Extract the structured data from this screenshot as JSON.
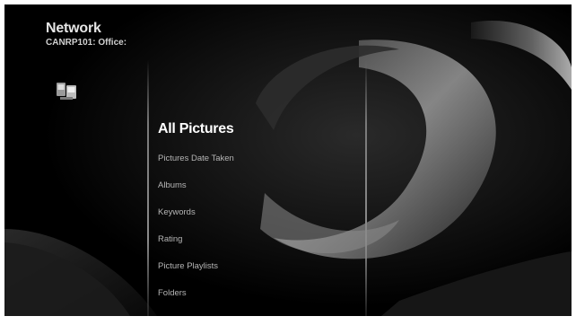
{
  "header": {
    "title": "Network",
    "subtitle": "CANRP101: Office:"
  },
  "icons": {
    "network": "network-computers-icon"
  },
  "menu": {
    "items": [
      {
        "label": "All Pictures",
        "selected": true
      },
      {
        "label": "Pictures Date Taken",
        "selected": false
      },
      {
        "label": "Albums",
        "selected": false
      },
      {
        "label": "Keywords",
        "selected": false
      },
      {
        "label": "Rating",
        "selected": false
      },
      {
        "label": "Picture Playlists",
        "selected": false
      },
      {
        "label": "Folders",
        "selected": false
      }
    ]
  },
  "colors": {
    "background": "#000000",
    "selected_text": "#ffffff",
    "item_text": "#b5b5b5"
  }
}
